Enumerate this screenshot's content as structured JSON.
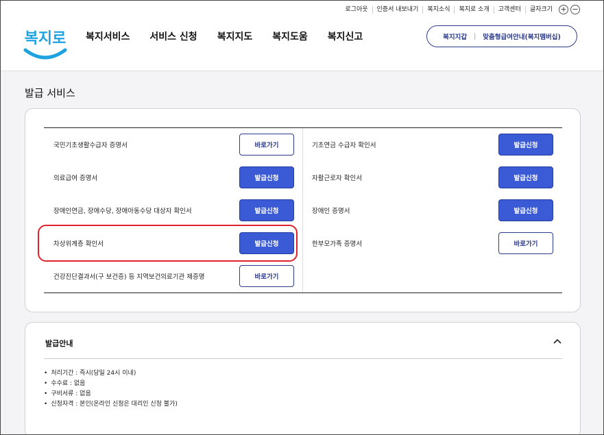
{
  "header": {
    "util_links": [
      "로그아웃",
      "인증서 내보내기",
      "복지소식",
      "복지로 소개",
      "고객센터",
      "글자크기"
    ],
    "zoom_in": "+",
    "zoom_out": "−",
    "logo_text": "복지로",
    "nav": [
      "복지서비스",
      "서비스 신청",
      "복지지도",
      "복지도움",
      "복지신고"
    ],
    "pill": {
      "left": "복지지갑",
      "sep": "|",
      "right": "맞춤형급여안내(복지멤버십)"
    }
  },
  "page_title": "발급 서비스",
  "services": {
    "left": [
      {
        "label": "국민기초생활수급자 증명서",
        "button": "바로가기",
        "style": "outline"
      },
      {
        "label": "의료급여 증명서",
        "button": "발급신청",
        "style": "filled"
      },
      {
        "label": "장애인연금, 장애수당, 장애아동수당 대상자 확인서",
        "button": "발급신청",
        "style": "filled"
      },
      {
        "label": "차상위계층 확인서",
        "button": "발급신청",
        "style": "filled"
      },
      {
        "label": "건강진단결과서(구 보건증) 등 지역보건의료기관 제증명",
        "button": "바로가기",
        "style": "outline"
      }
    ],
    "right": [
      {
        "label": "기초연금 수급자 확인서",
        "button": "발급신청",
        "style": "filled"
      },
      {
        "label": "자활근로자 확인서",
        "button": "발급신청",
        "style": "filled"
      },
      {
        "label": "장애인 증명서",
        "button": "발급신청",
        "style": "filled"
      },
      {
        "label": "한부모가족 증명서",
        "button": "바로가기",
        "style": "outline"
      }
    ]
  },
  "info": {
    "title": "발급안내",
    "items": [
      "처리기간 : 즉시(당일 24시 이내)",
      "수수료 : 없음",
      "구비서류 : 없음",
      "신청자격 : 본인(온라인 신청은 대리인 신청 불가)"
    ]
  },
  "colors": {
    "primary": "#3b5bd6",
    "navy": "#2c3a8a",
    "highlight": "#e0202a",
    "logo_blue": "#1fa3e0"
  }
}
